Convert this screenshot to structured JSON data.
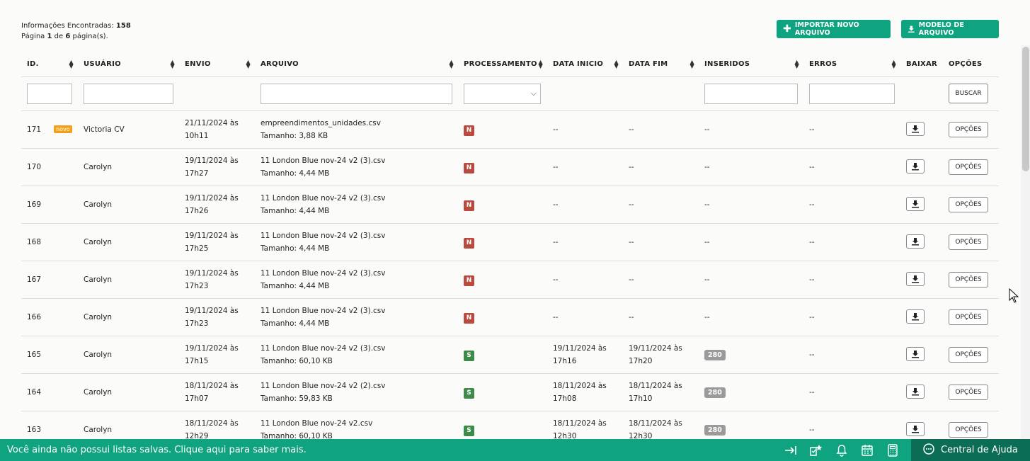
{
  "info": {
    "found_label": "Informações Encontradas:",
    "found_count": "158",
    "page_prefix": "Página",
    "page_current": "1",
    "page_mid": "de",
    "page_total": "6",
    "page_suffix": "página(s)."
  },
  "buttons": {
    "import": "IMPORTAR NOVO ARQUIVO",
    "model": "MODELO DE ARQUIVO",
    "search": "BUSCAR",
    "options": "OPÇÕES"
  },
  "columns": [
    "ID.",
    "USUÁRIO",
    "ENVIO",
    "ARQUIVO",
    "PROCESSAMENTO",
    "DATA INICIO",
    "DATA FIM",
    "INSERIDOS",
    "ERROS",
    "BAIXAR",
    "OPÇÕES"
  ],
  "rows": [
    {
      "id": "171",
      "badge": "novo",
      "user": "Victoria CV",
      "envio1": "21/11/2024 às",
      "envio2": "10h11",
      "file": "empreendimentos_unidades.csv",
      "size": "Tamanho: 3,88 KB",
      "status": "N",
      "ini1": "--",
      "ini2": "",
      "fim1": "--",
      "fim2": "",
      "ins": "--",
      "err": "--"
    },
    {
      "id": "170",
      "badge": "",
      "user": "Carolyn",
      "envio1": "19/11/2024 às",
      "envio2": "17h27",
      "file": "11 London Blue nov-24 v2 (3).csv",
      "size": "Tamanho: 4,44 MB",
      "status": "N",
      "ini1": "--",
      "ini2": "",
      "fim1": "--",
      "fim2": "",
      "ins": "--",
      "err": "--"
    },
    {
      "id": "169",
      "badge": "",
      "user": "Carolyn",
      "envio1": "19/11/2024 às",
      "envio2": "17h26",
      "file": "11 London Blue nov-24 v2 (3).csv",
      "size": "Tamanho: 4,44 MB",
      "status": "N",
      "ini1": "--",
      "ini2": "",
      "fim1": "--",
      "fim2": "",
      "ins": "--",
      "err": "--"
    },
    {
      "id": "168",
      "badge": "",
      "user": "Carolyn",
      "envio1": "19/11/2024 às",
      "envio2": "17h25",
      "file": "11 London Blue nov-24 v2 (3).csv",
      "size": "Tamanho: 4,44 MB",
      "status": "N",
      "ini1": "--",
      "ini2": "",
      "fim1": "--",
      "fim2": "",
      "ins": "--",
      "err": "--"
    },
    {
      "id": "167",
      "badge": "",
      "user": "Carolyn",
      "envio1": "19/11/2024 às",
      "envio2": "17h23",
      "file": "11 London Blue nov-24 v2 (3).csv",
      "size": "Tamanho: 4,44 MB",
      "status": "N",
      "ini1": "--",
      "ini2": "",
      "fim1": "--",
      "fim2": "",
      "ins": "--",
      "err": "--"
    },
    {
      "id": "166",
      "badge": "",
      "user": "Carolyn",
      "envio1": "19/11/2024 às",
      "envio2": "17h23",
      "file": "11 London Blue nov-24 v2 (3).csv",
      "size": "Tamanho: 4,44 MB",
      "status": "N",
      "ini1": "--",
      "ini2": "",
      "fim1": "--",
      "fim2": "",
      "ins": "--",
      "err": "--"
    },
    {
      "id": "165",
      "badge": "",
      "user": "Carolyn",
      "envio1": "19/11/2024 às",
      "envio2": "17h15",
      "file": "11 London Blue nov-24 v2 (3).csv",
      "size": "Tamanho: 60,10 KB",
      "status": "S",
      "ini1": "19/11/2024 às",
      "ini2": "17h16",
      "fim1": "19/11/2024 às",
      "fim2": "17h20",
      "ins": "280",
      "err": "--"
    },
    {
      "id": "164",
      "badge": "",
      "user": "Carolyn",
      "envio1": "18/11/2024 às",
      "envio2": "17h07",
      "file": "11 London Blue nov-24 v2 (2).csv",
      "size": "Tamanho: 59,83 KB",
      "status": "S",
      "ini1": "18/11/2024 às",
      "ini2": "17h08",
      "fim1": "18/11/2024 às",
      "fim2": "17h10",
      "ins": "280",
      "err": "--"
    },
    {
      "id": "163",
      "badge": "",
      "user": "Carolyn",
      "envio1": "18/11/2024 às",
      "envio2": "12h29",
      "file": "11 London Blue nov-24 v2.csv",
      "size": "Tamanho: 60,10 KB",
      "status": "S",
      "ini1": "18/11/2024 às",
      "ini2": "12h30",
      "fim1": "18/11/2024 às",
      "fim2": "12h30",
      "ins": "280",
      "err": "--"
    }
  ],
  "footer": {
    "message": "Você ainda não possui listas salvas. Clique aqui para saber mais.",
    "help": "Central de Ajuda",
    "icons": [
      "collapse-arrow-icon",
      "star-list-icon",
      "bell-icon",
      "calendar-icon",
      "calculator-icon",
      "chat-icon"
    ]
  },
  "colors": {
    "accent": "#10a37f",
    "footer_dark": "#0b6d55",
    "status_n": "#b84a40",
    "status_s": "#3e8a4a",
    "novo": "#f0a01a"
  }
}
